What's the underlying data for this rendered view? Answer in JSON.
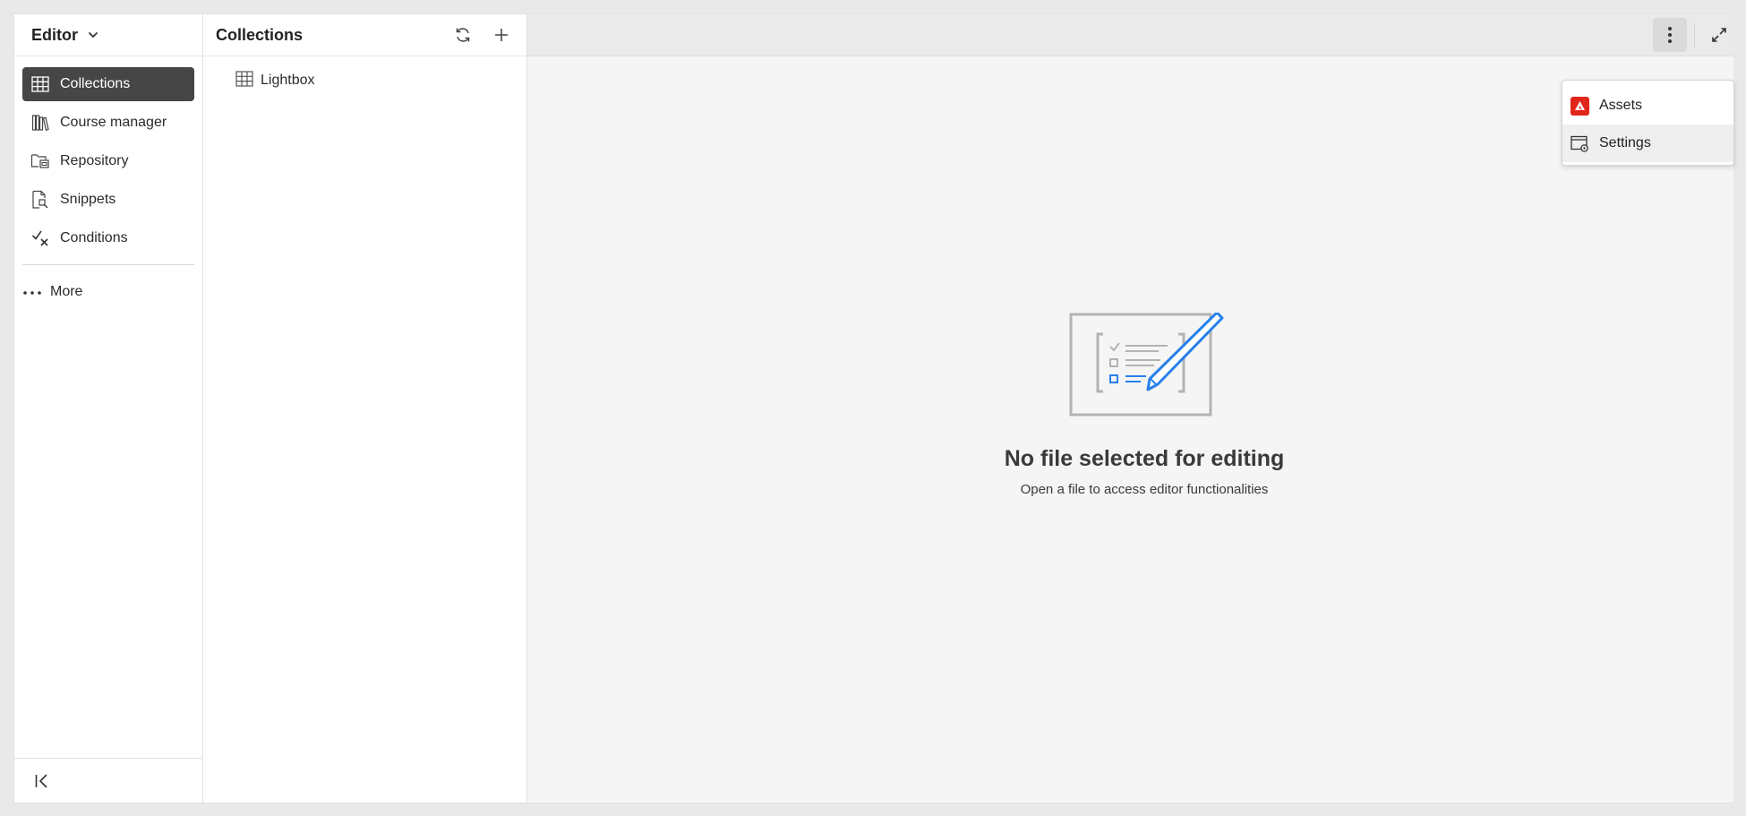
{
  "nav": {
    "title": "Editor",
    "items": [
      {
        "label": "Collections",
        "icon": "grid-icon",
        "active": true
      },
      {
        "label": "Course manager",
        "icon": "books-icon",
        "active": false
      },
      {
        "label": "Repository",
        "icon": "folder-icon",
        "active": false
      },
      {
        "label": "Snippets",
        "icon": "snippet-icon",
        "active": false
      },
      {
        "label": "Conditions",
        "icon": "check-x-icon",
        "active": false
      }
    ],
    "more_label": "More"
  },
  "panel": {
    "title": "Collections",
    "items": [
      {
        "label": "Lightbox",
        "icon": "grid-icon"
      }
    ]
  },
  "menu": {
    "items": [
      {
        "label": "Assets",
        "icon": "adobe-icon"
      },
      {
        "label": "Settings",
        "icon": "settings-window-icon"
      }
    ]
  },
  "empty_state": {
    "title": "No file selected for editing",
    "subtitle": "Open a file to access editor functionalities"
  },
  "colors": {
    "active_nav_bg": "#464646",
    "accent_blue": "#2680eb",
    "adobe_red": "#e1251b"
  }
}
